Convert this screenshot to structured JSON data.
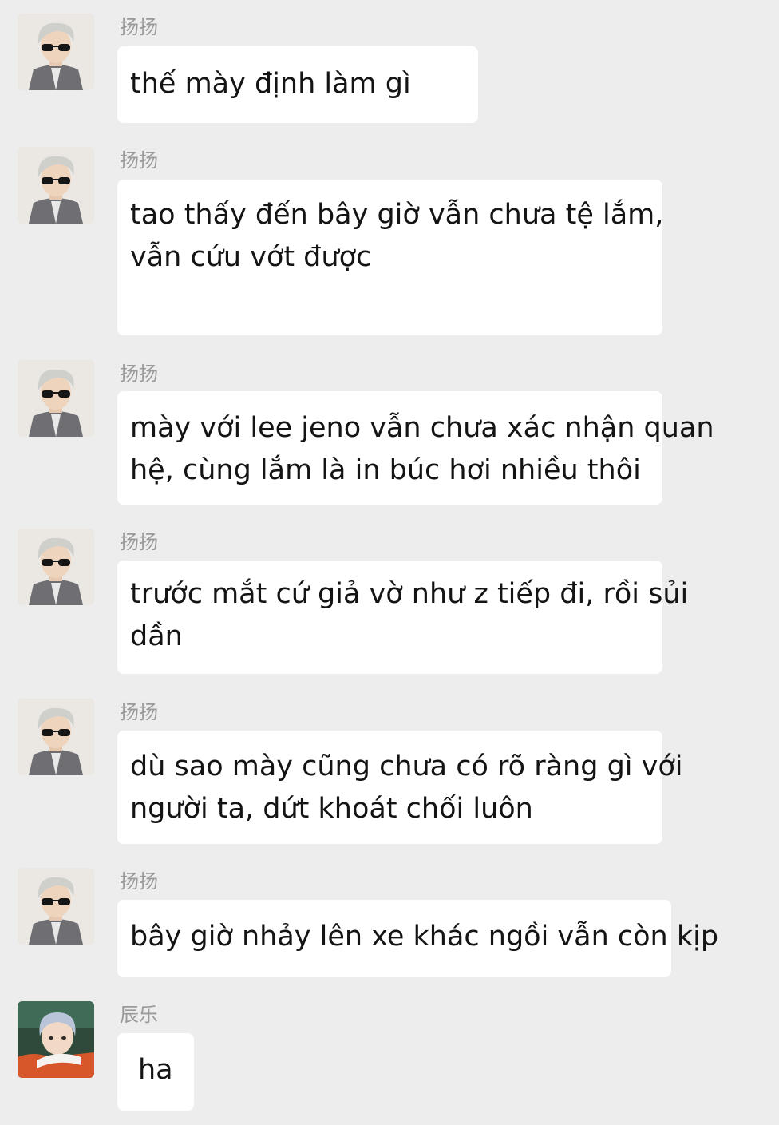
{
  "conversation": {
    "messages": [
      {
        "sender": "扬扬",
        "avatar": "sunglasses-avatar",
        "lines": [
          "thế mày định làm gì"
        ]
      },
      {
        "sender": "扬扬",
        "avatar": "sunglasses-avatar",
        "lines": [
          "tao thấy đến bây giờ vẫn chưa tệ lắm,",
          "vẫn cứu vớt được"
        ]
      },
      {
        "sender": "扬扬",
        "avatar": "sunglasses-avatar",
        "lines": [
          "mày với lee jeno vẫn chưa xác nhận quan",
          "hệ, cùng lắm là in búc hơi nhiều thôi"
        ]
      },
      {
        "sender": "扬扬",
        "avatar": "sunglasses-avatar",
        "lines": [
          "trước mắt cứ giả vờ như z tiếp đi, rồi sủi",
          "dần"
        ]
      },
      {
        "sender": "扬扬",
        "avatar": "sunglasses-avatar",
        "lines": [
          "dù sao mày cũng chưa có rõ ràng gì với",
          "người ta, dứt khoát chối luôn"
        ]
      },
      {
        "sender": "扬扬",
        "avatar": "sunglasses-avatar",
        "lines": [
          "bây giờ nhảy lên xe khác ngồi vẫn còn kịp"
        ]
      },
      {
        "sender": "辰乐",
        "avatar": "car-avatar",
        "lines": [
          "ha"
        ]
      }
    ]
  },
  "colors": {
    "background": "#ededed",
    "bubble": "#ffffff",
    "sender_name": "#9a9a9a",
    "message_text": "#141414"
  }
}
